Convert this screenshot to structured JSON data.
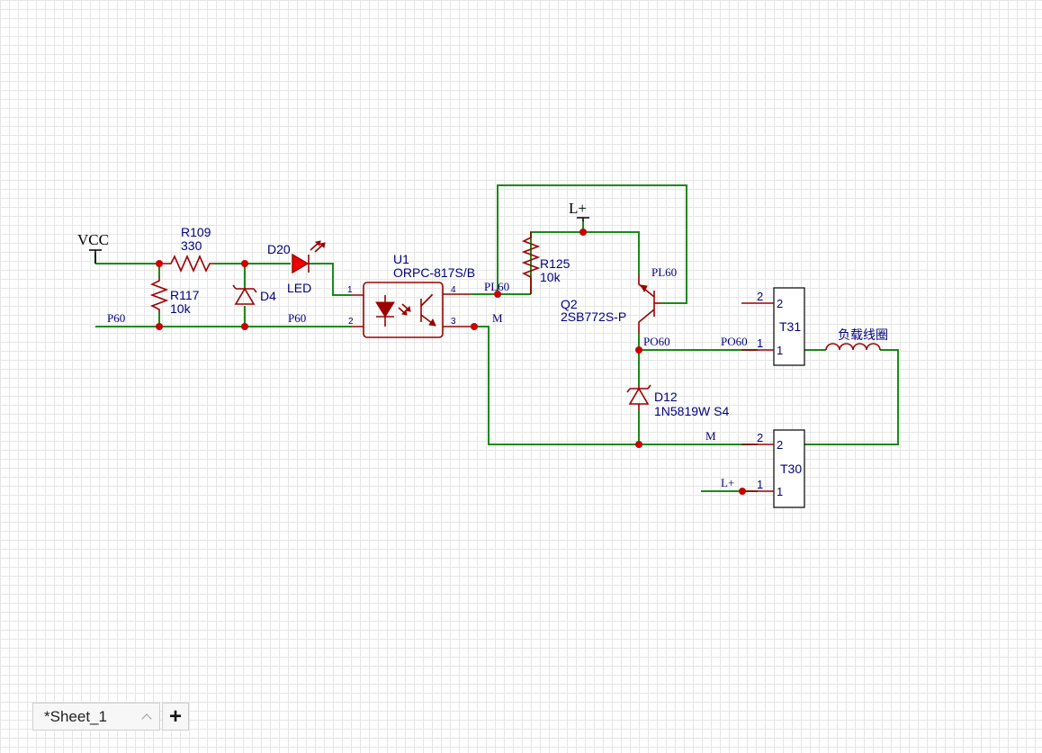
{
  "power": {
    "vcc": "VCC",
    "lplus": "L+"
  },
  "components": {
    "r109": {
      "designator": "R109",
      "value": "330"
    },
    "r117": {
      "designator": "R117",
      "value": "10k"
    },
    "d4": {
      "designator": "D4"
    },
    "d20": {
      "designator": "D20",
      "value": "LED"
    },
    "u1": {
      "designator": "U1",
      "value": "ORPC-817S/B"
    },
    "r125": {
      "designator": "R125",
      "value": "10k"
    },
    "q2": {
      "designator": "Q2",
      "value": "2SB772S-P"
    },
    "d12": {
      "designator": "D12",
      "value": "1N5819W S4"
    },
    "t31": {
      "designator": "T31"
    },
    "t30": {
      "designator": "T30"
    },
    "coil": {
      "label": "负载线圈"
    }
  },
  "nets": {
    "p60_left": "P60",
    "p60_mid": "P60",
    "pl60_u1": "PL60",
    "pl60_q2": "PL60",
    "m_u1": "M",
    "m_t30": "M",
    "po60_node": "PO60",
    "po60_t31": "PO60",
    "lplus_t30": "L+"
  },
  "pins": {
    "u1_1": "1",
    "u1_2": "2",
    "u1_3": "3",
    "u1_4": "4",
    "t31_ext_2": "2",
    "t31_ext_1": "1",
    "t31_in_2": "2",
    "t31_in_1": "1",
    "t30_ext_2": "2",
    "t30_ext_1": "1",
    "t30_in_2": "2",
    "t30_in_1": "1"
  },
  "sheets": {
    "active_tab": "*Sheet_1",
    "add_label": "+"
  },
  "colors": {
    "wire": "#1a8a1a",
    "part": "#9a0000",
    "junction": "#cc0000",
    "led": "#ee0000"
  }
}
